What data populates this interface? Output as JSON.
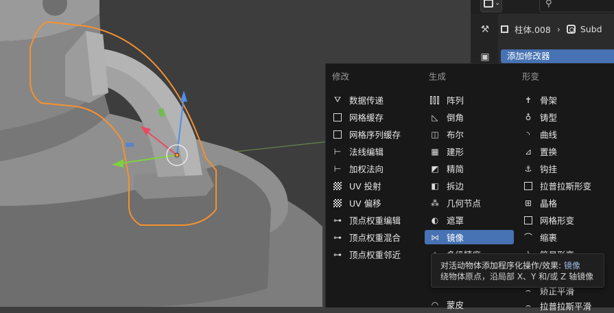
{
  "properties": {
    "object_name": "柱体.008",
    "modifier_name": "Subd",
    "add_modifier_label": "添加修改器"
  },
  "menu": {
    "columns": [
      {
        "header": "修改",
        "items": [
          {
            "label": "数据传递",
            "icon": "data-transfer-icon"
          },
          {
            "label": "网格缓存",
            "icon": "mesh-cache-icon"
          },
          {
            "label": "网格序列缓存",
            "icon": "mesh-sequence-cache-icon"
          },
          {
            "label": "法线编辑",
            "icon": "normal-edit-icon"
          },
          {
            "label": "加权法向",
            "icon": "weighted-normal-icon"
          },
          {
            "label": "UV 投射",
            "icon": "uv-project-icon"
          },
          {
            "label": "UV 偏移",
            "icon": "uv-warp-icon"
          },
          {
            "label": "顶点权重编辑",
            "icon": "vertex-weight-edit-icon"
          },
          {
            "label": "顶点权重混合",
            "icon": "vertex-weight-mix-icon"
          },
          {
            "label": "顶点权重邻近",
            "icon": "vertex-weight-proximity-icon"
          }
        ]
      },
      {
        "header": "生成",
        "items": [
          {
            "label": "阵列",
            "icon": "array-icon"
          },
          {
            "label": "倒角",
            "icon": "bevel-icon"
          },
          {
            "label": "布尔",
            "icon": "boolean-icon"
          },
          {
            "label": "建形",
            "icon": "build-icon"
          },
          {
            "label": "精简",
            "icon": "decimate-icon"
          },
          {
            "label": "拆边",
            "icon": "edge-split-icon"
          },
          {
            "label": "几何节点",
            "icon": "geometry-nodes-icon"
          },
          {
            "label": "遮罩",
            "icon": "mask-icon"
          },
          {
            "label": "镜像",
            "icon": "mirror-icon"
          },
          {
            "label": "多级精度",
            "icon": "multires-icon"
          },
          {
            "label": "螺旋",
            "icon": "screw-icon"
          },
          {
            "label": "蒙皮",
            "icon": "skin-icon"
          }
        ]
      },
      {
        "header": "形变",
        "items": [
          {
            "label": "骨架",
            "icon": "armature-icon"
          },
          {
            "label": "铸型",
            "icon": "cast-icon"
          },
          {
            "label": "曲线",
            "icon": "curve-icon"
          },
          {
            "label": "置换",
            "icon": "displace-icon"
          },
          {
            "label": "钩挂",
            "icon": "hook-icon"
          },
          {
            "label": "拉普拉斯形变",
            "icon": "laplacian-deform-icon"
          },
          {
            "label": "晶格",
            "icon": "lattice-icon"
          },
          {
            "label": "网格形变",
            "icon": "mesh-deform-icon"
          },
          {
            "label": "缩裹",
            "icon": "shrinkwrap-icon"
          },
          {
            "label": "简易形变",
            "icon": "simple-deform-icon"
          },
          {
            "label": "矫正平滑",
            "icon": "corrective-smooth-icon"
          },
          {
            "label": "拉普拉斯平滑",
            "icon": "laplacian-smooth-icon"
          }
        ]
      }
    ],
    "active_item": "镜像"
  },
  "tooltip": {
    "line1_prefix": "对活动物体添加程序化操作/效果: ",
    "line1_highlight": "镜像",
    "line2": "绕物体原点，沿局部 X、Y 和/或 Z 轴镜像"
  },
  "colors": {
    "accent": "#4772b3",
    "selection_outline": "#f5922f",
    "menu_bg": "#181818"
  }
}
